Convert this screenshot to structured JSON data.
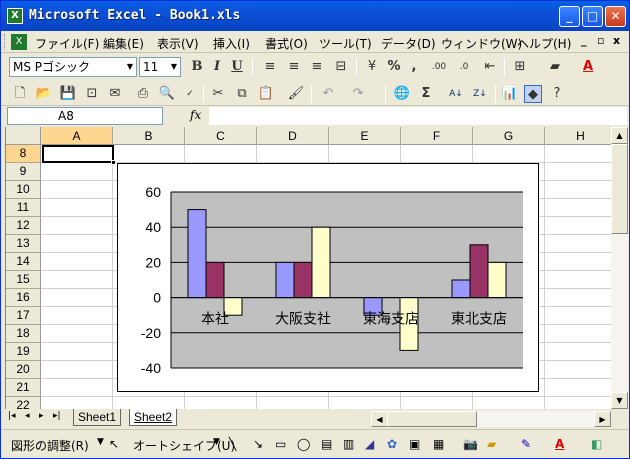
{
  "window": {
    "title": "Microsoft Excel - Book1.xls",
    "app_icon": "X",
    "controls": {
      "minimize": "_",
      "maximize": "□",
      "close": "✕"
    }
  },
  "menubar": {
    "items": [
      "ファイル(F)",
      "編集(E)",
      "表示(V)",
      "挿入(I)",
      "書式(O)",
      "ツール(T)",
      "データ(D)",
      "ウィンドウ(W)",
      "ヘルプ(H)"
    ],
    "doc_controls": {
      "minimize": "_",
      "restore": "▫",
      "close": "x"
    }
  },
  "format_toolbar": {
    "font_name": "MS Pゴシック",
    "font_size": "11",
    "bold": "B",
    "italic": "I",
    "underline": "U",
    "percent": "%",
    "comma": ",",
    "increase_decimal": ".00",
    "decrease_decimal": ".0",
    "font_color_glyph": "A"
  },
  "standard_toolbar": {
    "sum_glyph": "Σ",
    "sort_asc": "A↓",
    "sort_desc": "Z↓"
  },
  "formula_bar": {
    "name_box": "A8",
    "fx_label": "fx",
    "formula": ""
  },
  "grid": {
    "columns": [
      "A",
      "B",
      "C",
      "D",
      "E",
      "F",
      "G",
      "H"
    ],
    "selected_column": "A",
    "rows": [
      "8",
      "9",
      "10",
      "11",
      "12",
      "13",
      "14",
      "15",
      "16",
      "17",
      "18",
      "19",
      "20",
      "21",
      "22"
    ],
    "selected_row": "8",
    "active_cell": "A8"
  },
  "chart_data": {
    "type": "bar",
    "categories": [
      "本社",
      "大阪支社",
      "東海支店",
      "東北支店"
    ],
    "series": [
      {
        "values": [
          50,
          20,
          -10,
          10
        ],
        "color": "#9999ff"
      },
      {
        "values": [
          20,
          20,
          0,
          30
        ],
        "color": "#993366"
      },
      {
        "values": [
          -10,
          40,
          -30,
          20
        ],
        "color": "#ffffcc"
      }
    ],
    "ylim": [
      -40,
      60
    ],
    "yticks": [
      -40,
      -20,
      0,
      20,
      40,
      60
    ],
    "ytick_labels": [
      "-40",
      "-20",
      "0",
      "20",
      "40",
      "60"
    ],
    "grid": true,
    "plot_background": "#c0c0c0",
    "title": "",
    "xlabel": "",
    "ylabel": ""
  },
  "sheet_tabs": {
    "nav": [
      "|◂",
      "◂",
      "▸",
      "▸|"
    ],
    "tabs": [
      "Sheet1",
      "Sheet2"
    ],
    "active": "Sheet2"
  },
  "drawing_toolbar": {
    "draw_menu": "図形の調整(R)",
    "autoshape_menu": "オートシェイプ(U)",
    "font_color_glyph": "A"
  }
}
